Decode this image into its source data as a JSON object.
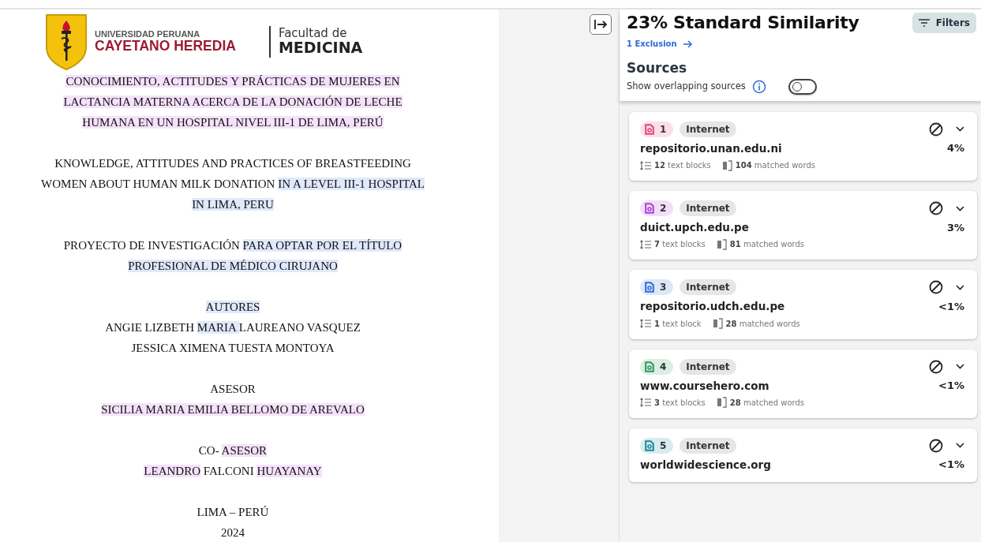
{
  "document": {
    "logo": {
      "university_line1": "UNIVERSIDAD PERUANA",
      "university_line2": "CAYETANO HEREDIA",
      "faculty_line1": "Facultad de",
      "faculty_line2": "MEDICINA"
    },
    "blocks": [
      {
        "lines": [
          [
            {
              "text": "CONOCIMIENTO, ACTITUDES Y PRÁCTICAS DE MUJERES EN",
              "color": "#f6e1fb"
            }
          ],
          [
            {
              "text": "LACTANCIA MATERNA ACERCA DE LA DONACIÓN DE LECHE",
              "color": "#f6e1fb"
            }
          ],
          [
            {
              "text": "HUMANA EN UN HOSPITAL NIVEL III-1 DE LIMA, PERÚ",
              "color": "#f6e1fb"
            }
          ]
        ]
      },
      {
        "lines": [
          [
            {
              "text": "KNOWLEDGE, ATTITUDES AND PRACTICES OF BREASTFEEDING"
            }
          ],
          [
            {
              "text": "WOMEN ABOUT HUMAN MILK DONATION "
            },
            {
              "text": "IN A LEVEL III-1 HOSPITAL",
              "color": "#e0e9fb"
            }
          ],
          [
            {
              "text": "IN LIMA, PERU",
              "color": "#e0e9fb"
            }
          ]
        ]
      },
      {
        "lines": [
          [
            {
              "text": "PROYECTO DE INVESTIGACIÓN "
            },
            {
              "text": "PARA OPTAR POR EL TÍTULO",
              "color": "#e0e9fb"
            }
          ],
          [
            {
              "text": "PROFESIONAL DE MÉDICO CIRUJANO",
              "color": "#e0e9fb"
            }
          ]
        ]
      },
      {
        "lines": [
          [
            {
              "text": "AUTORES",
              "color": "#e0e9fb"
            }
          ],
          [
            {
              "text": "ANGIE LIZBETH "
            },
            {
              "text": "MARIA ",
              "color": "#e0e9fb"
            },
            {
              "text": "LAUREANO VASQUEZ"
            }
          ],
          [
            {
              "text": "JESSICA XIMENA TUESTA MONTOYA"
            }
          ]
        ]
      },
      {
        "lines": [
          [
            {
              "text": "ASESOR"
            }
          ],
          [
            {
              "text": "SICILIA MARIA EMILIA BELLOMO DE AREVALO",
              "color": "#f6e1fb"
            }
          ]
        ]
      },
      {
        "lines": [
          [
            {
              "text": "CO- "
            },
            {
              "text": "ASESOR",
              "color": "#f6e1fb"
            }
          ],
          [
            {
              "text": "LEANDRO",
              "color": "#f6e1fb"
            },
            {
              "text": " FALCONI "
            },
            {
              "text": "HUAYANAY",
              "color": "#f6e1fb"
            }
          ]
        ]
      },
      {
        "lines": [
          [
            {
              "text": "LIMA – PERÚ"
            }
          ],
          [
            {
              "text": "2024"
            }
          ]
        ]
      }
    ]
  },
  "panel": {
    "title": "23% Standard Similarity",
    "filters_button": "Filters",
    "exclusion_link": "1 Exclusion",
    "sources_heading": "Sources",
    "overlap_label": "Show overlapping sources",
    "overlap_toggle": {
      "on": false
    },
    "sources": [
      {
        "number": "1",
        "color": "#e0457b",
        "type": "Internet",
        "name": "repositorio.unan.edu.ni",
        "percent": "4%",
        "blocks_count": "12",
        "blocks_label": "text blocks",
        "words_count": "104",
        "words_label": "matched words"
      },
      {
        "number": "2",
        "color": "#b03fd6",
        "type": "Internet",
        "name": "duict.upch.edu.pe",
        "percent": "3%",
        "blocks_count": "7",
        "blocks_label": "text blocks",
        "words_count": "81",
        "words_label": "matched words"
      },
      {
        "number": "3",
        "color": "#2f6fd6",
        "type": "Internet",
        "name": "repositorio.udch.edu.pe",
        "percent": "<1%",
        "blocks_count": "1",
        "blocks_label": "text block",
        "words_count": "28",
        "words_label": "matched words"
      },
      {
        "number": "4",
        "color": "#2a9a5a",
        "type": "Internet",
        "name": "www.coursehero.com",
        "percent": "<1%",
        "blocks_count": "3",
        "blocks_label": "text blocks",
        "words_count": "28",
        "words_label": "matched words"
      },
      {
        "number": "5",
        "color": "#1a8a9a",
        "type": "Internet",
        "name": "worldwidescience.org",
        "percent": "<1%"
      }
    ]
  }
}
